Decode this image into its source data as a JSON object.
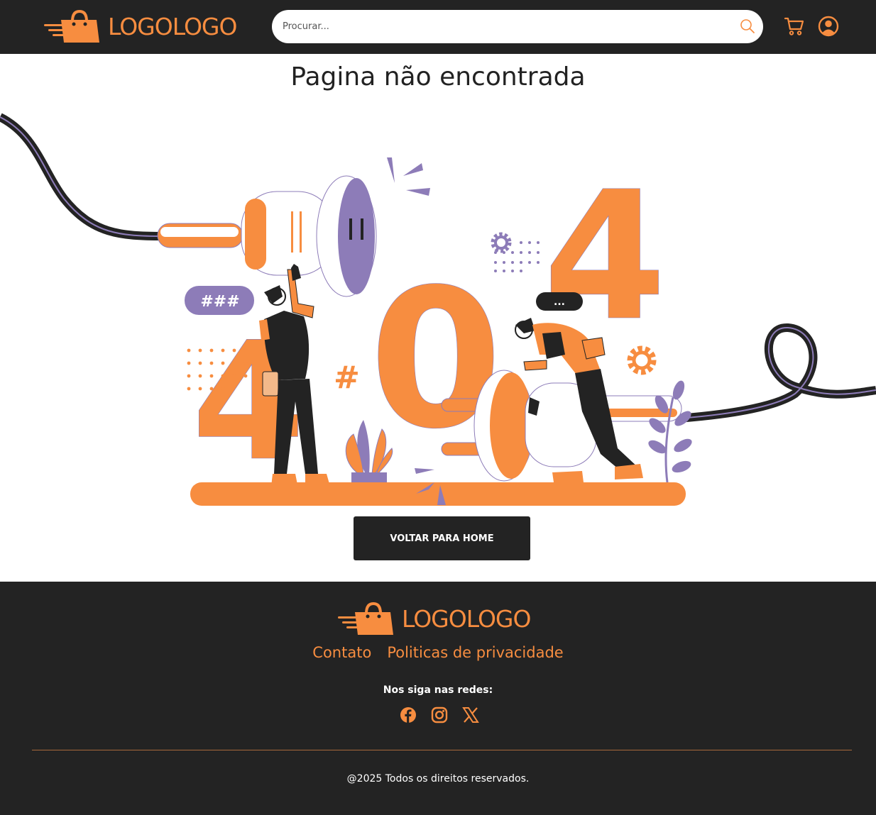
{
  "header": {
    "logo_text": "LOGOLOGO",
    "search": {
      "placeholder": "Procurar..."
    },
    "icons": [
      "search-icon",
      "cart-icon",
      "user-icon"
    ]
  },
  "main": {
    "title": "Pagina não encontrada",
    "illustration": {
      "big_text": [
        "4",
        "0",
        "4"
      ],
      "bubble_left": "###",
      "bubble_right": "...",
      "hash": "#"
    },
    "home_button": "VOLTAR PARA HOME"
  },
  "footer": {
    "logo_text": "LOGOLOGO",
    "links": [
      "Contato",
      "Politicas de privacidade"
    ],
    "social_title": "Nos siga nas redes:",
    "social_icons": [
      "facebook-icon",
      "instagram-icon",
      "x-icon"
    ],
    "copyright": "@2025 Todos os direitos reservados."
  },
  "colors": {
    "accent": "#f78d40",
    "dark": "#232323",
    "purple": "#8d7cb8",
    "white": "#ffffff"
  }
}
